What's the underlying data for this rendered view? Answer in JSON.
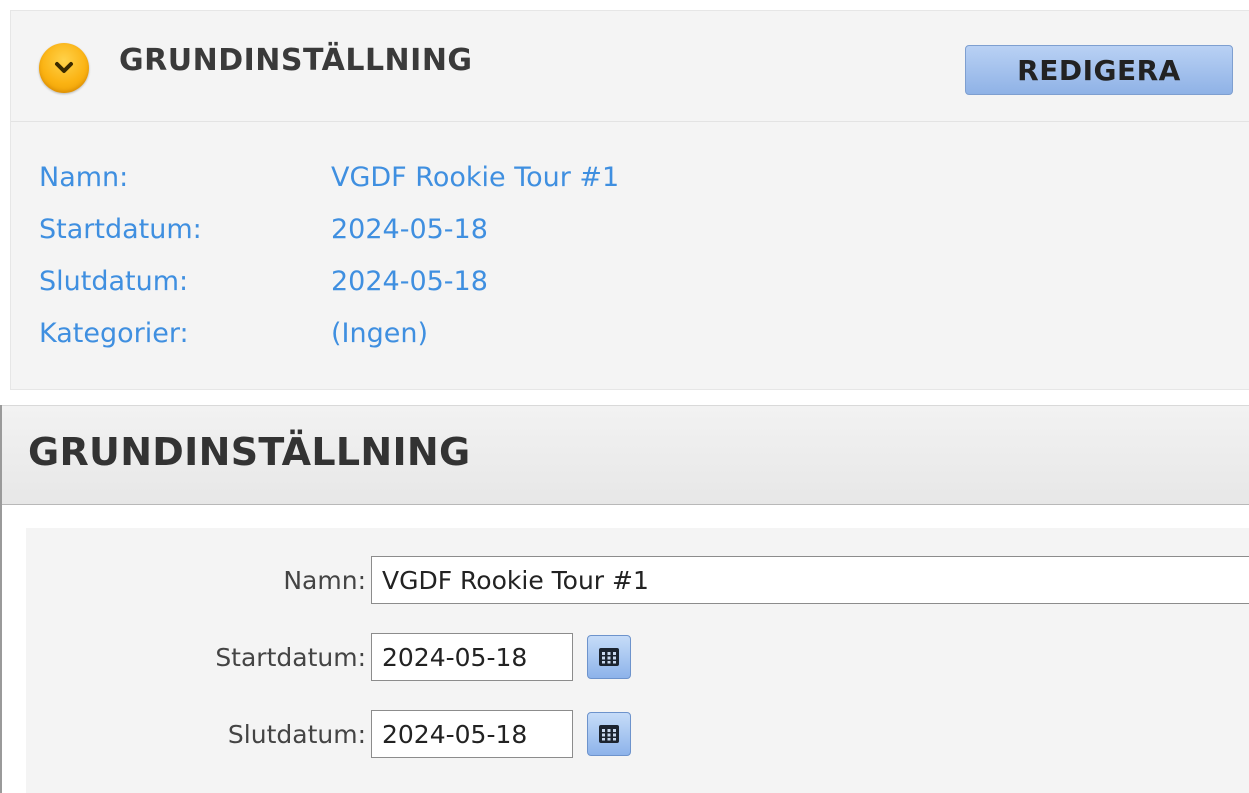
{
  "view_panel": {
    "title": "GRUNDINSTÄLLNING",
    "edit_button_label": "REDIGERA",
    "toggle_icon": "chevron-down-icon",
    "fields": [
      {
        "label": "Namn:",
        "value": "VGDF Rookie Tour #1"
      },
      {
        "label": "Startdatum:",
        "value": "2024-05-18"
      },
      {
        "label": "Slutdatum:",
        "value": "2024-05-18"
      },
      {
        "label": "Kategorier:",
        "value": "(Ingen)"
      }
    ],
    "colors": {
      "accent_text": "#3f8fe0",
      "toggle_icon": "#fbb313",
      "button_bg": "#a9c6f0"
    }
  },
  "edit_panel": {
    "title": "GRUNDINSTÄLLNING",
    "name_label": "Namn:",
    "name_value": "VGDF Rookie Tour #1",
    "start_label": "Startdatum:",
    "start_value": "2024-05-18",
    "end_label": "Slutdatum:",
    "end_value": "2024-05-18",
    "calendar_icon": "calendar-icon"
  }
}
